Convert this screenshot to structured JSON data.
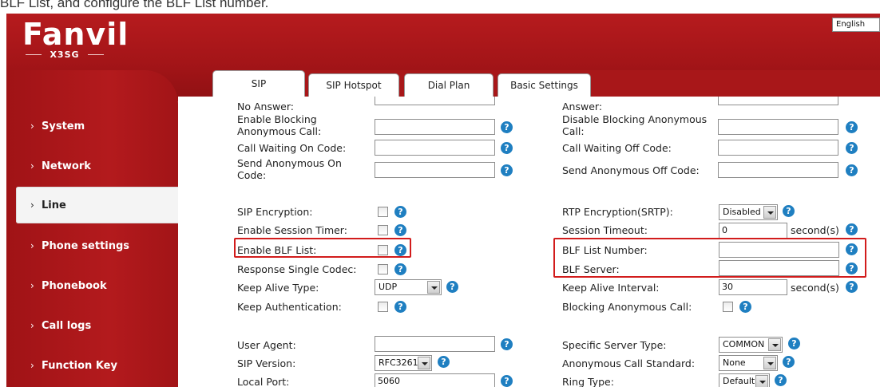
{
  "caption": "BLF List, and configure the BLF List number.",
  "header": {
    "logo_word": "Fanvil",
    "logo_model": "X3SG",
    "language": "English"
  },
  "sidebar": {
    "items": [
      {
        "label": "System"
      },
      {
        "label": "Network"
      },
      {
        "label": "Line"
      },
      {
        "label": "Phone settings"
      },
      {
        "label": "Phonebook"
      },
      {
        "label": "Call logs"
      },
      {
        "label": "Function Key"
      }
    ]
  },
  "tabs": [
    {
      "label": "SIP"
    },
    {
      "label": "SIP Hotspot"
    },
    {
      "label": "Dial Plan"
    },
    {
      "label": "Basic Settings"
    }
  ],
  "form": {
    "top_left_cut": "No Answer:",
    "top_right_cut": "Answer:",
    "enable_blocking_anon": "Enable Blocking Anonymous Call:",
    "disable_blocking_anon": "Disable Blocking Anonymous Call:",
    "cw_on_code": "Call Waiting On Code:",
    "cw_off_code": "Call Waiting Off Code:",
    "send_anon_on": "Send Anonymous On Code:",
    "send_anon_off": "Send Anonymous Off Code:",
    "sip_encryption": "SIP Encryption:",
    "rtp_encryption": "RTP Encryption(SRTP):",
    "rtp_encryption_value": "Disabled",
    "enable_session_timer": "Enable Session Timer:",
    "session_timeout": "Session Timeout:",
    "session_timeout_value": "0",
    "seconds_unit": "second(s)",
    "enable_blf_list": "Enable BLF List:",
    "blf_list_number": "BLF List Number:",
    "response_single_codec": "Response Single Codec:",
    "blf_server": "BLF Server:",
    "keep_alive_type": "Keep Alive Type:",
    "keep_alive_type_value": "UDP",
    "keep_alive_interval": "Keep Alive Interval:",
    "keep_alive_interval_value": "30",
    "keep_authentication": "Keep Authentication:",
    "blocking_anon_call": "Blocking Anonymous Call:",
    "user_agent": "User Agent:",
    "specific_server_type": "Specific Server Type:",
    "specific_server_type_value": "COMMON",
    "sip_version": "SIP Version:",
    "sip_version_value": "RFC3261",
    "anon_call_standard": "Anonymous Call Standard:",
    "anon_call_standard_value": "None",
    "local_port": "Local Port:",
    "local_port_value": "5060",
    "ring_type": "Ring Type:",
    "ring_type_value": "Default",
    "help_glyph": "?"
  },
  "colors": {
    "brand_red": "#a81719",
    "help_blue": "#1f7fc1",
    "highlight": "#d21c1c"
  }
}
